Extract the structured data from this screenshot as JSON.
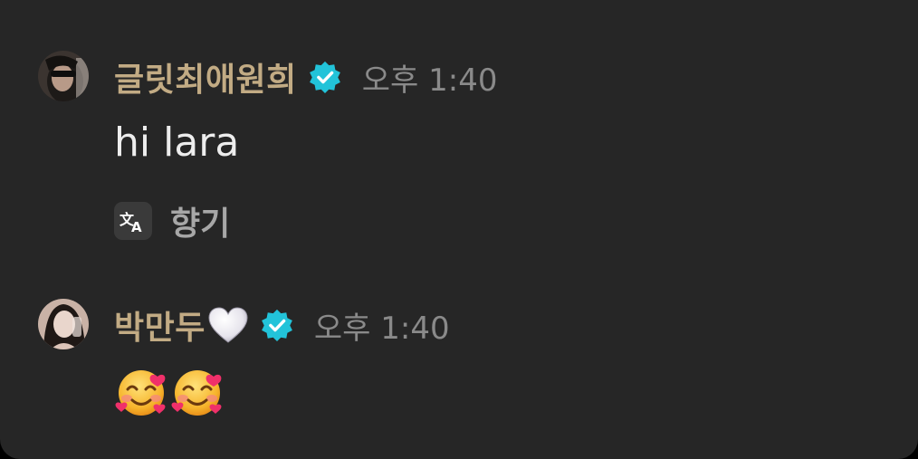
{
  "messages": [
    {
      "avatar_icon": "user-avatar-photo",
      "username": "글릿최애원희",
      "verified_icon": "verified-badge-icon",
      "timestamp": "오후 1:40",
      "text": "hi lara",
      "translation": {
        "icon": "translate-icon",
        "text": "향기"
      }
    },
    {
      "avatar_icon": "user-avatar-photo",
      "username": "박만두",
      "name_suffix_icon": "white-heart-emoji",
      "verified_icon": "verified-badge-icon",
      "timestamp": "오후 1:40",
      "emojis": [
        "smiling-face-with-hearts-emoji",
        "smiling-face-with-hearts-emoji"
      ]
    }
  ],
  "colors": {
    "background": "#262626",
    "username": "#c2ab84",
    "timestamp": "#8a8a8a",
    "message_text": "#ededed",
    "verified_badge": "#22c3d9"
  }
}
